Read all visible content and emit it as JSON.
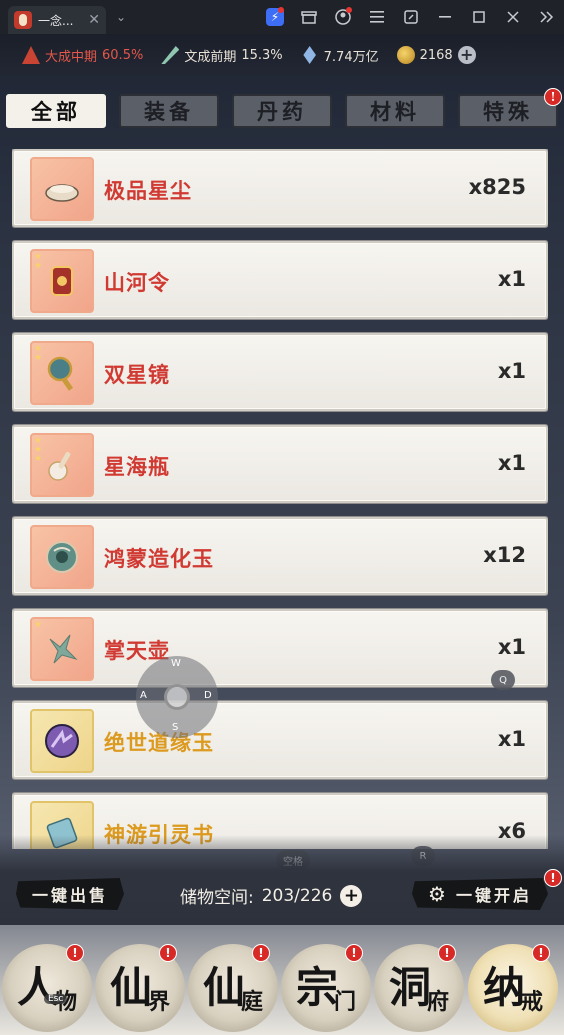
{
  "titlebar": {
    "tab_title": "一念...",
    "close_glyph": "✕",
    "chevron_glyph": "⌄",
    "buttons": [
      "lightning-icon",
      "gift-icon",
      "user-icon",
      "menu-icon",
      "restore-icon",
      "minimize-icon",
      "maximize-icon",
      "close-icon",
      "more-icon"
    ]
  },
  "status": {
    "realm1": {
      "label": "大成中期",
      "pct": "60.5%"
    },
    "realm2": {
      "label": "文成前期",
      "pct": "15.3%"
    },
    "spirit_stones": "7.74万亿",
    "gold": "2168"
  },
  "categories": {
    "all": "全部",
    "equipment": "装备",
    "pills": "丹药",
    "materials": "材料",
    "special": "特殊",
    "special_badge": "!"
  },
  "items": [
    {
      "name": "极品星尘",
      "qty": "x825",
      "rarity": "red"
    },
    {
      "name": "山河令",
      "qty": "x1",
      "rarity": "red"
    },
    {
      "name": "双星镜",
      "qty": "x1",
      "rarity": "red"
    },
    {
      "name": "星海瓶",
      "qty": "x1",
      "rarity": "red"
    },
    {
      "name": "鸿蒙造化玉",
      "qty": "x12",
      "rarity": "red"
    },
    {
      "name": "掌天壶",
      "qty": "x1",
      "rarity": "red"
    },
    {
      "name": "绝世道缘玉",
      "qty": "x1",
      "rarity": "gold"
    },
    {
      "name": "神游引灵书",
      "qty": "x6",
      "rarity": "gold"
    }
  ],
  "bottom": {
    "sell_all": "一键出售",
    "storage_label": "储物空间:",
    "storage_value": "203/226",
    "open_all": "一键开启",
    "open_badge": "!"
  },
  "key_hints": {
    "w": "W",
    "a": "A",
    "s": "S",
    "d": "D",
    "q": "Q",
    "r": "R",
    "space": "空格",
    "esc": "Esc"
  },
  "nav": [
    {
      "big": "人",
      "small": "物",
      "badge": "!"
    },
    {
      "big": "仙",
      "small": "界",
      "badge": "!"
    },
    {
      "big": "仙",
      "small": "庭",
      "badge": "!"
    },
    {
      "big": "宗",
      "small": "门",
      "badge": "!"
    },
    {
      "big": "洞",
      "small": "府",
      "badge": "!"
    },
    {
      "big": "纳",
      "small": "戒",
      "badge": "!"
    }
  ]
}
